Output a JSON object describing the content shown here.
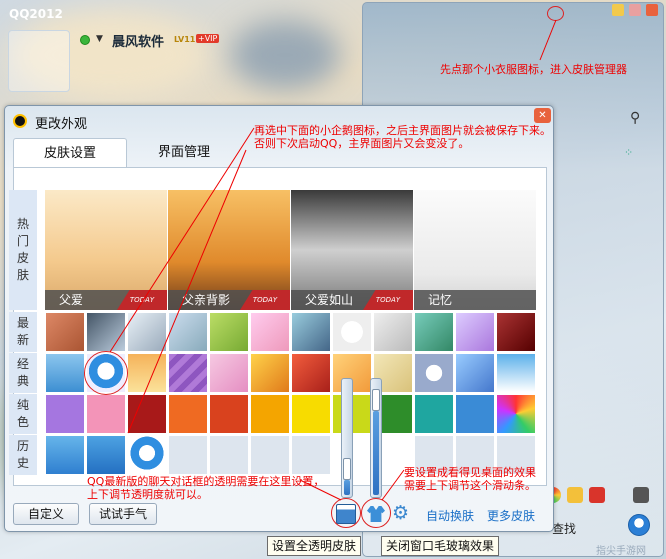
{
  "qq": {
    "title": "QQ2012",
    "nickname": "晨风软件",
    "level": "LV11",
    "vip": "+VIP",
    "find_label": "查找"
  },
  "dialog": {
    "title": "更改外观",
    "tabs": [
      "皮肤设置",
      "界面管理"
    ],
    "categories": {
      "hot": "热门皮肤",
      "latest": "最新",
      "classic": "经典",
      "solid": "纯色",
      "history": "历史"
    },
    "hot_skins": [
      {
        "label": "父爱",
        "badge": "TODAY"
      },
      {
        "label": "父亲背影",
        "badge": "TODAY"
      },
      {
        "label": "父爱如山",
        "badge": "TODAY"
      },
      {
        "label": "记忆",
        "badge": ""
      }
    ],
    "buttons": {
      "custom": "自定义",
      "luck": "试试手气",
      "auto_change": "自动换肤",
      "more_skins": "更多皮肤"
    }
  },
  "tooltips": {
    "transparent": "设置全透明皮肤",
    "glass_off": "关闭窗口毛玻璃效果"
  },
  "annotations": {
    "right_top": "先点那个小衣服图标，进入皮肤管理器",
    "center_top_1": "再选中下面的小企鹅图标，之后主界面图片就会被保存下来。",
    "center_top_2": "否则下次启动QQ，主界面图片又会变没了。",
    "bottom_left_1": "QQ最新版的聊天对话框的透明需要在这里设置，",
    "bottom_left_2": "上下调节透明度就可以。",
    "bottom_right_1": "要设置成看得见桌面的效果",
    "bottom_right_2": "需要上下调节这个滑动条。"
  },
  "sliders": {
    "transparency_level": 0.18,
    "glass_level": 0.92
  },
  "watermark": "指尖手游网",
  "colors": {
    "annotation": "#e00000",
    "link": "#1a6fc7"
  }
}
